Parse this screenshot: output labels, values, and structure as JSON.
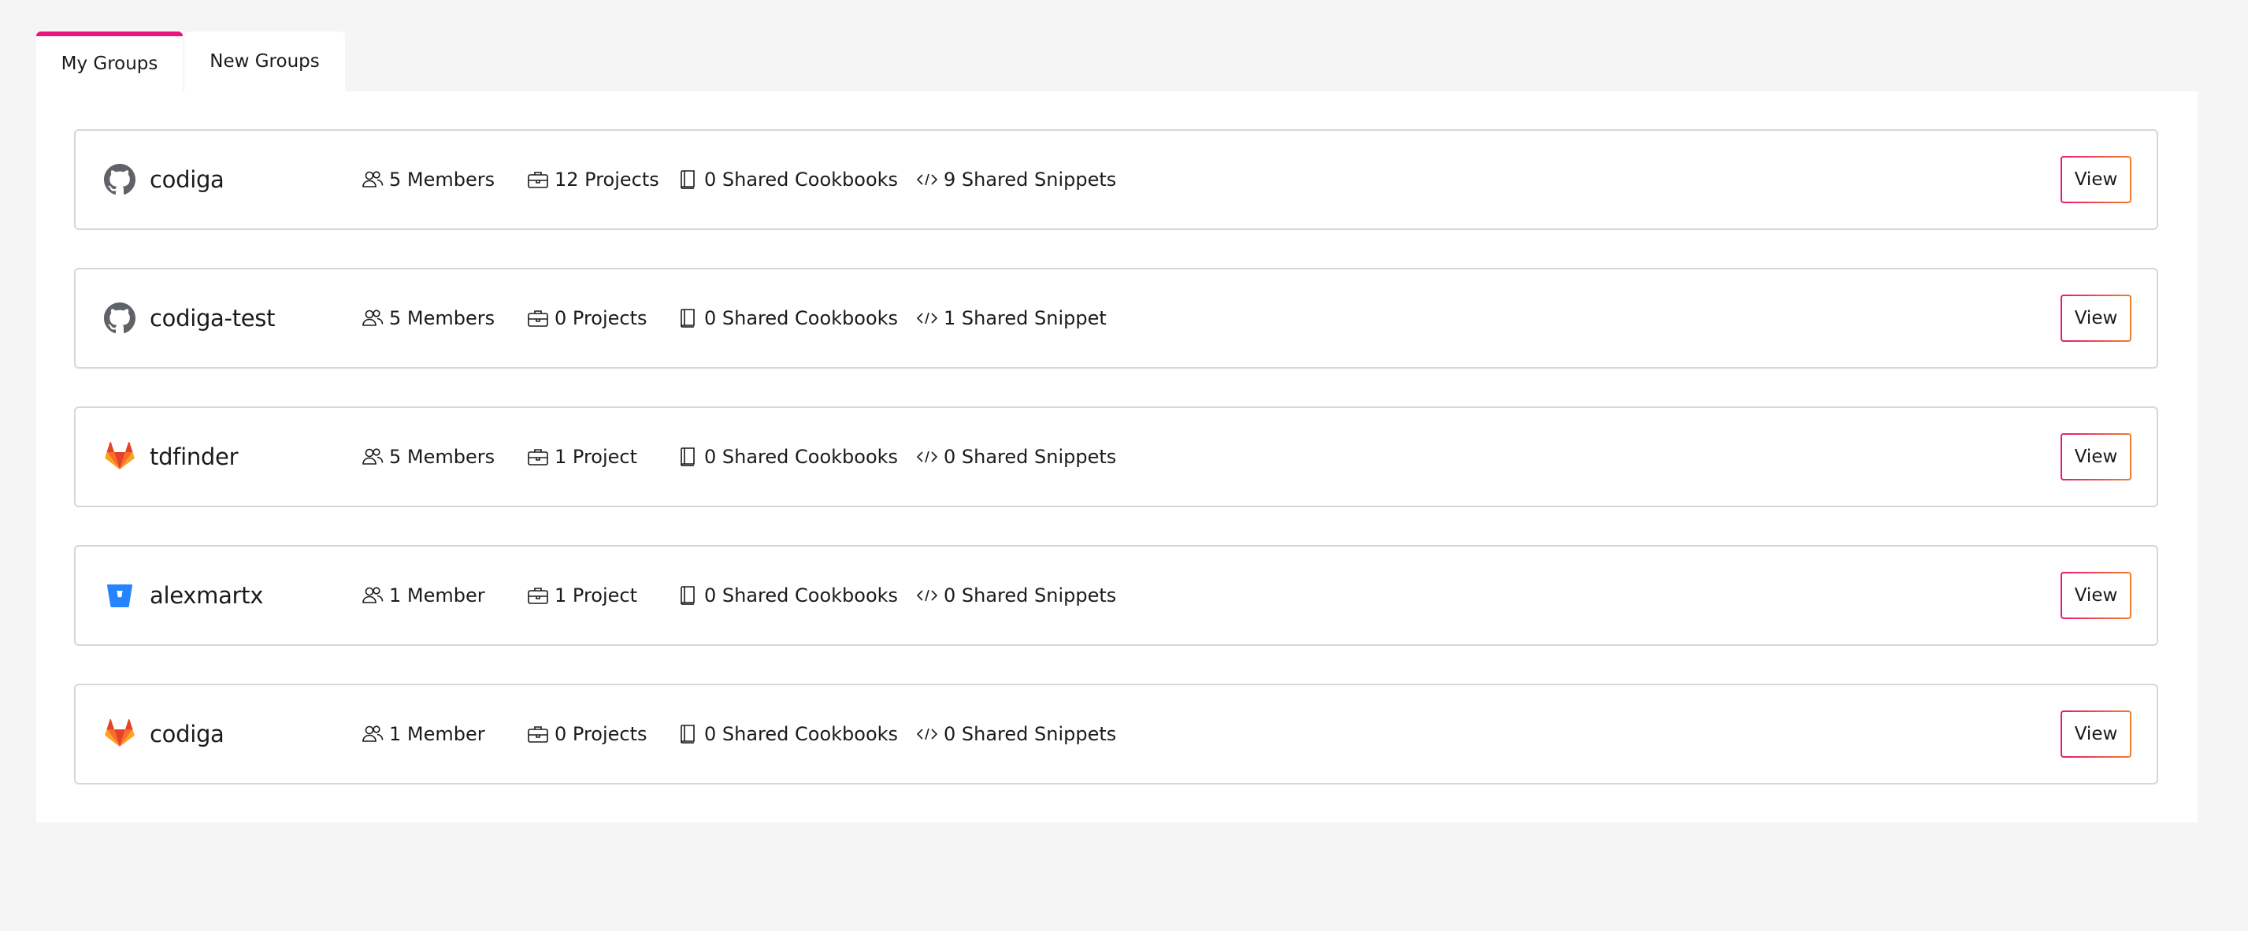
{
  "tabs": {
    "my_groups": "My Groups",
    "new_groups": "New Groups"
  },
  "accent_color": "#e8157e",
  "groups": [
    {
      "provider": "github-icon",
      "name": "codiga",
      "members": "5 Members",
      "projects": "12 Projects",
      "cookbooks": "0 Shared Cookbooks",
      "snippets": "9 Shared Snippets",
      "action": "View"
    },
    {
      "provider": "github-icon",
      "name": "codiga-test",
      "members": "5 Members",
      "projects": "0 Projects",
      "cookbooks": "0 Shared Cookbooks",
      "snippets": "1 Shared Snippet",
      "action": "View"
    },
    {
      "provider": "gitlab-icon",
      "name": "tdfinder",
      "members": "5 Members",
      "projects": "1 Project",
      "cookbooks": "0 Shared Cookbooks",
      "snippets": "0 Shared Snippets",
      "action": "View"
    },
    {
      "provider": "bitbucket-icon",
      "name": "alexmartx",
      "members": "1 Member",
      "projects": "1 Project",
      "cookbooks": "0 Shared Cookbooks",
      "snippets": "0 Shared Snippets",
      "action": "View"
    },
    {
      "provider": "gitlab-icon",
      "name": "codiga",
      "members": "1 Member",
      "projects": "0 Projects",
      "cookbooks": "0 Shared Cookbooks",
      "snippets": "0 Shared Snippets",
      "action": "View"
    }
  ]
}
